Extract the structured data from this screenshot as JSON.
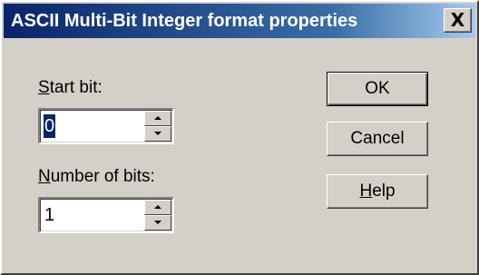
{
  "window": {
    "title": "ASCII Multi-Bit Integer format properties",
    "close_glyph": "X"
  },
  "fields": {
    "start_bit": {
      "label_mnemonic": "S",
      "label_rest": "tart bit:",
      "value": "0"
    },
    "number_of_bits": {
      "label_mnemonic": "N",
      "label_rest": "umber of bits:",
      "value": "1"
    }
  },
  "buttons": {
    "ok": "OK",
    "cancel": "Cancel",
    "help_mnemonic": "H",
    "help_rest": "elp"
  },
  "icons": {
    "close": "close-icon",
    "spin_up": "spin-up-arrow-icon",
    "spin_down": "spin-down-arrow-icon"
  },
  "colors": {
    "face": "#d4d0c8",
    "title_start": "#0a246a",
    "title_end": "#a6caf0",
    "selection": "#0a246a"
  }
}
